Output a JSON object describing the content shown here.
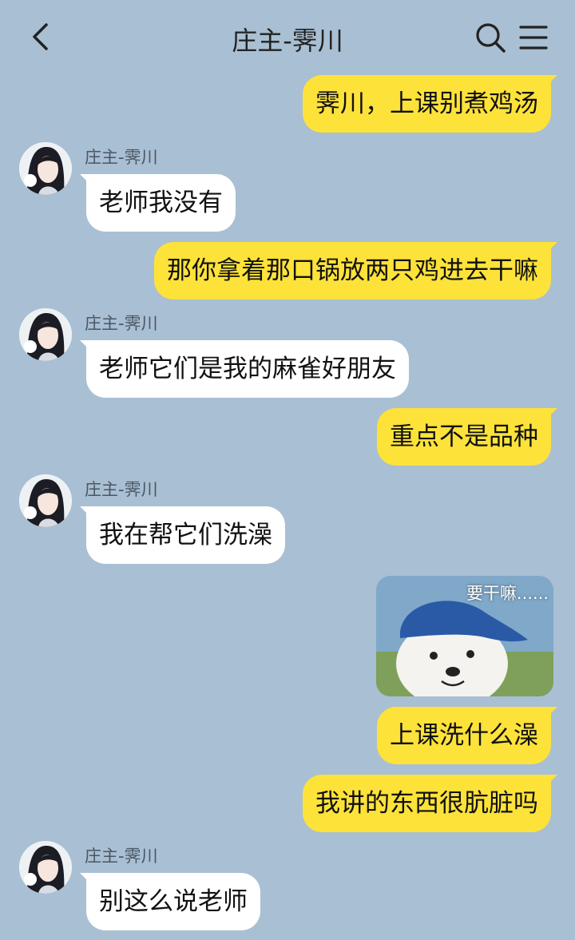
{
  "header": {
    "title": "庄主-霁川",
    "back_icon": "chevron-left-icon",
    "search_icon": "search-icon",
    "menu_icon": "hamburger-menu-icon"
  },
  "colors": {
    "background": "#a9bfd3",
    "outgoing_bubble": "#fde23a",
    "incoming_bubble": "#ffffff"
  },
  "messages": [
    {
      "side": "right",
      "text": "霁川，上课别煮鸡汤"
    },
    {
      "side": "left",
      "sender": "庄主-霁川",
      "text": "老师我没有"
    },
    {
      "side": "right",
      "text": "那你拿着那口锅放两只鸡进去干嘛"
    },
    {
      "side": "left",
      "sender": "庄主-霁川",
      "text": "老师它们是我的麻雀好朋友"
    },
    {
      "side": "right",
      "text": "重点不是品种"
    },
    {
      "side": "left",
      "sender": "庄主-霁川",
      "text": "我在帮它们洗澡"
    },
    {
      "side": "right",
      "type": "sticker",
      "caption": "要干嘛......"
    },
    {
      "side": "right",
      "text": "上课洗什么澡"
    },
    {
      "side": "right",
      "text": "我讲的东西很肮脏吗"
    },
    {
      "side": "left",
      "sender": "庄主-霁川",
      "text": "别这么说老师"
    }
  ]
}
